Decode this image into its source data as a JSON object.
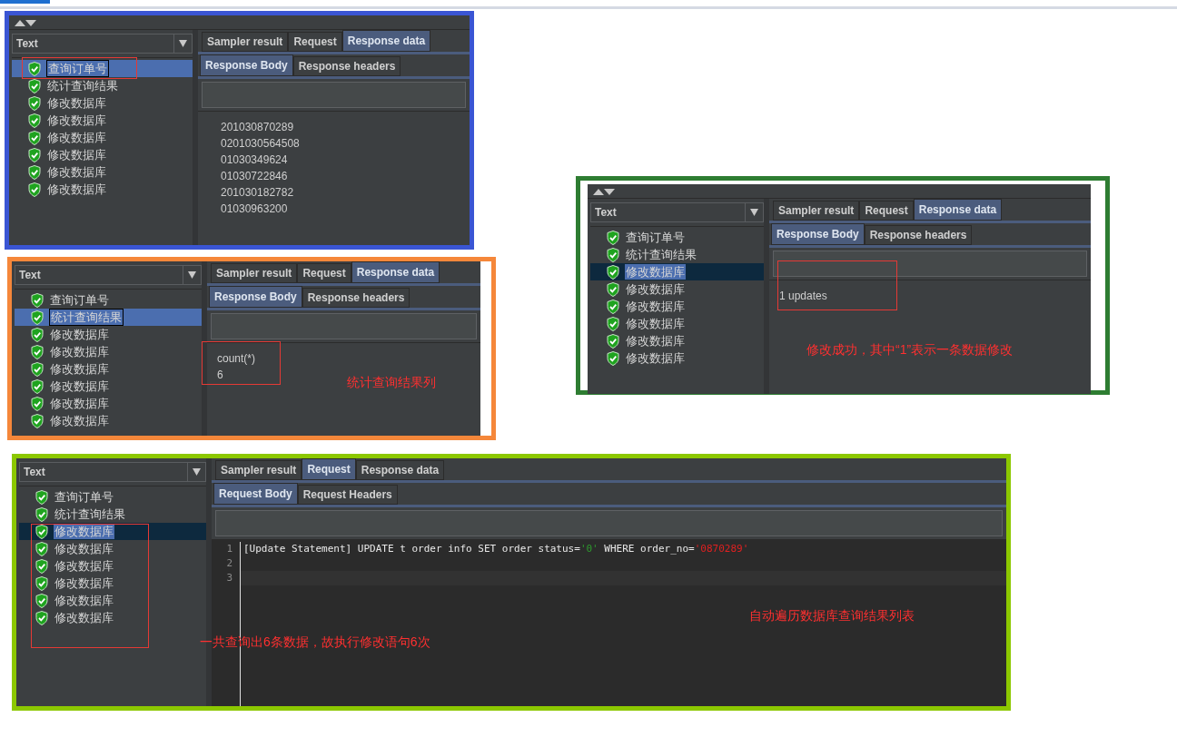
{
  "panels": [
    {
      "tree_header": "Text",
      "tree_focused": true,
      "tree": [
        {
          "label": "查询订单号",
          "selected": true
        },
        {
          "label": "统计查询结果",
          "selected": false
        },
        {
          "label": "修改数据库",
          "selected": false
        },
        {
          "label": "修改数据库",
          "selected": false
        },
        {
          "label": "修改数据库",
          "selected": false
        },
        {
          "label": "修改数据库",
          "selected": false
        },
        {
          "label": "修改数据库",
          "selected": false
        },
        {
          "label": "修改数据库",
          "selected": false
        }
      ],
      "tabs": [
        {
          "label": "Sampler result",
          "selected": false
        },
        {
          "label": "Request",
          "selected": false
        },
        {
          "label": "Response data",
          "selected": true
        }
      ],
      "subtabs": [
        {
          "label": "Response Body",
          "selected": true
        },
        {
          "label": "Response headers",
          "selected": false
        }
      ],
      "body": {
        "kind": "text",
        "lines": [
          "201030870289",
          "0201030564508",
          "01030349624",
          "01030722846",
          "201030182782",
          "01030963200"
        ]
      }
    },
    {
      "tree_header": "Text",
      "tree_focused": true,
      "tree": [
        {
          "label": "查询订单号",
          "selected": false
        },
        {
          "label": "统计查询结果",
          "selected": true
        },
        {
          "label": "修改数据库",
          "selected": false
        },
        {
          "label": "修改数据库",
          "selected": false
        },
        {
          "label": "修改数据库",
          "selected": false
        },
        {
          "label": "修改数据库",
          "selected": false
        },
        {
          "label": "修改数据库",
          "selected": false
        },
        {
          "label": "修改数据库",
          "selected": false
        }
      ],
      "tabs": [
        {
          "label": "Sampler result",
          "selected": false
        },
        {
          "label": "Request",
          "selected": false
        },
        {
          "label": "Response data",
          "selected": true
        }
      ],
      "subtabs": [
        {
          "label": "Response Body",
          "selected": true
        },
        {
          "label": "Response headers",
          "selected": false
        }
      ],
      "body": {
        "kind": "text",
        "lines": [
          "count(*)",
          "6"
        ]
      },
      "notes": [
        "统计查询结果列"
      ]
    },
    {
      "tree_header": "Text",
      "tree_focused": false,
      "tree": [
        {
          "label": "查询订单号",
          "selected": false
        },
        {
          "label": "统计查询结果",
          "selected": false
        },
        {
          "label": "修改数据库",
          "selected": true
        },
        {
          "label": "修改数据库",
          "selected": false
        },
        {
          "label": "修改数据库",
          "selected": false
        },
        {
          "label": "修改数据库",
          "selected": false
        },
        {
          "label": "修改数据库",
          "selected": false
        },
        {
          "label": "修改数据库",
          "selected": false
        }
      ],
      "tabs": [
        {
          "label": "Sampler result",
          "selected": false
        },
        {
          "label": "Request",
          "selected": false
        },
        {
          "label": "Response data",
          "selected": true
        }
      ],
      "subtabs": [
        {
          "label": "Response Body",
          "selected": true
        },
        {
          "label": "Response headers",
          "selected": false
        }
      ],
      "body": {
        "kind": "text",
        "lines": [
          "1 updates"
        ]
      },
      "notes": [
        "修改成功，其中“1”表示一条数据修改"
      ]
    },
    {
      "tree_header": "Text",
      "tree_focused": false,
      "tree": [
        {
          "label": "查询订单号",
          "selected": false
        },
        {
          "label": "统计查询结果",
          "selected": false
        },
        {
          "label": "修改数据库",
          "selected": true
        },
        {
          "label": "修改数据库",
          "selected": false
        },
        {
          "label": "修改数据库",
          "selected": false
        },
        {
          "label": "修改数据库",
          "selected": false
        },
        {
          "label": "修改数据库",
          "selected": false
        },
        {
          "label": "修改数据库",
          "selected": false
        }
      ],
      "tabs": [
        {
          "label": "Sampler result",
          "selected": false
        },
        {
          "label": "Request",
          "selected": true
        },
        {
          "label": "Response data",
          "selected": false
        }
      ],
      "subtabs": [
        {
          "label": "Request Body",
          "selected": true
        },
        {
          "label": "Request Headers",
          "selected": false
        }
      ],
      "body": {
        "kind": "code",
        "lines": [
          {
            "number": "1",
            "segments": [
              {
                "kind": "plain",
                "text": "[Update Statement] UPDATE t order info SET order status="
              },
              {
                "kind": "string",
                "text": "'0'"
              },
              {
                "kind": "plain",
                "text": " WHERE order_no="
              },
              {
                "kind": "literal",
                "text": "'0870289'"
              }
            ]
          },
          {
            "number": "2"
          },
          {
            "number": "3"
          }
        ]
      },
      "notes": [
        "一共查询出6条数据，故执行修改语句6次",
        "自动遍历数据库查询结果列表"
      ]
    }
  ]
}
